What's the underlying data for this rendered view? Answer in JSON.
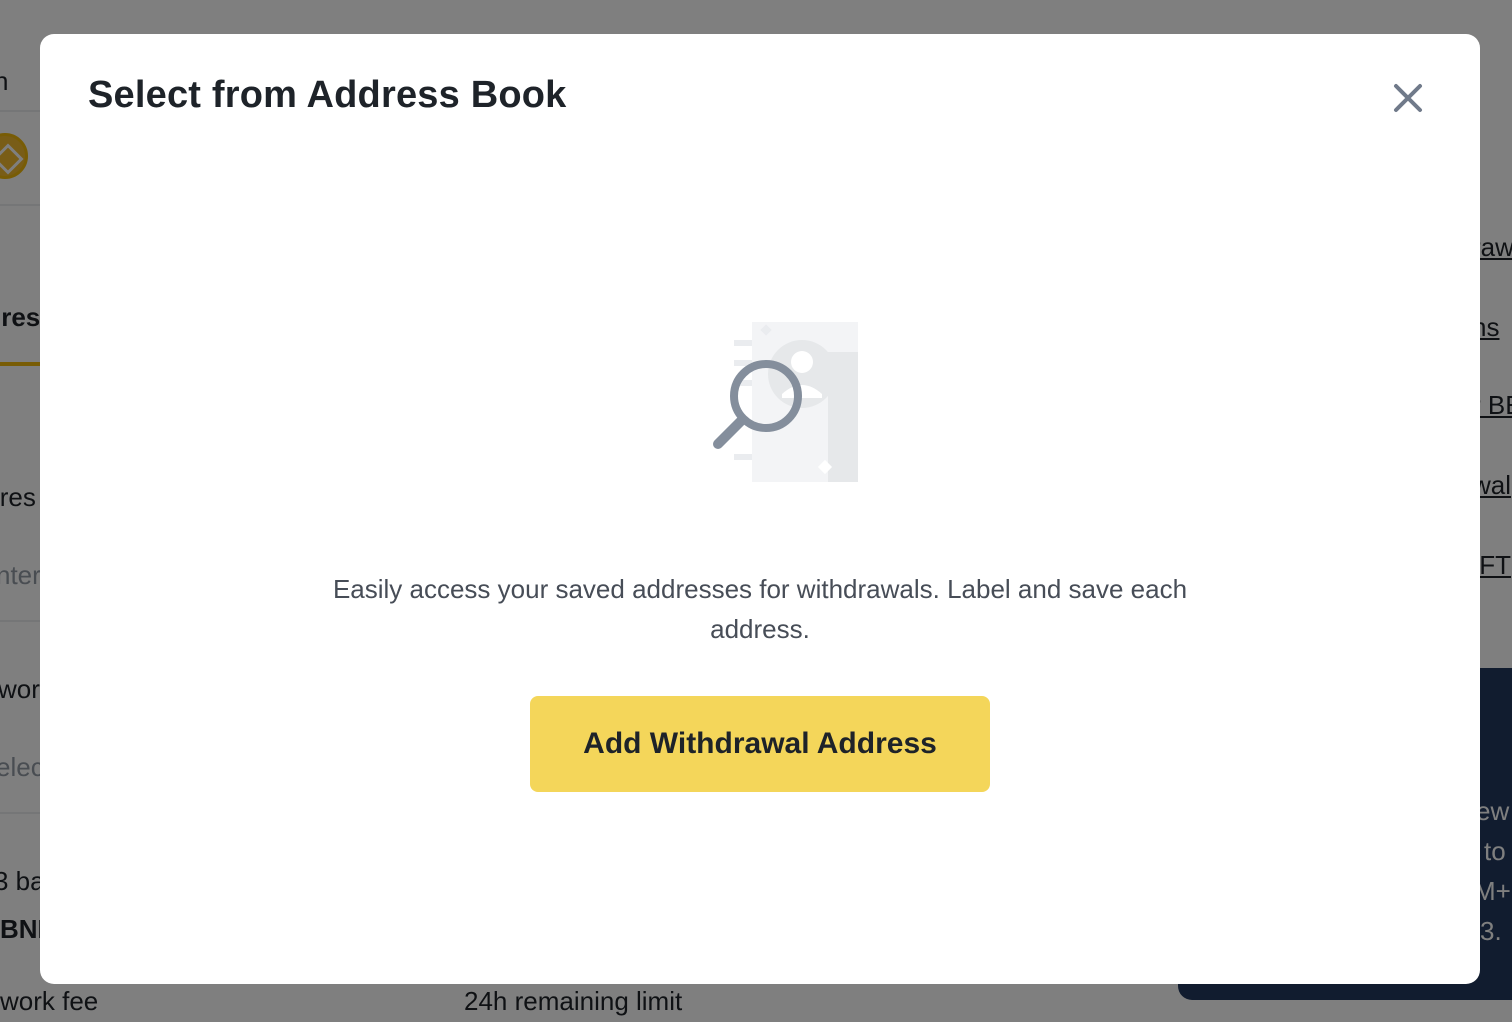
{
  "background": {
    "left_fragments": [
      "n",
      "lres",
      "lres",
      "nter",
      "wor",
      "elec",
      "3 ba",
      "BNI",
      "work fee"
    ],
    "middle_fragment": "24h remaining limit",
    "right_links": [
      "raw",
      "ns",
      "r BE",
      "wal",
      "IFT"
    ],
    "banner_lines": [
      "ew",
      "to",
      "M+",
      "3."
    ]
  },
  "modal": {
    "title": "Select from Address Book",
    "close_icon": "close-icon",
    "illustration_icon": "address-book-search-icon",
    "empty_message": "Easily access your saved addresses for withdrawals. Label and save each address.",
    "primary_button_label": "Add Withdrawal Address"
  },
  "colors": {
    "overlay": "rgba(0,0,0,0.5)",
    "modal_bg": "#ffffff",
    "primary_button": "#f4d65a",
    "title_text": "#1e2329",
    "body_text": "#474d57",
    "close_icon": "#707a8a"
  }
}
